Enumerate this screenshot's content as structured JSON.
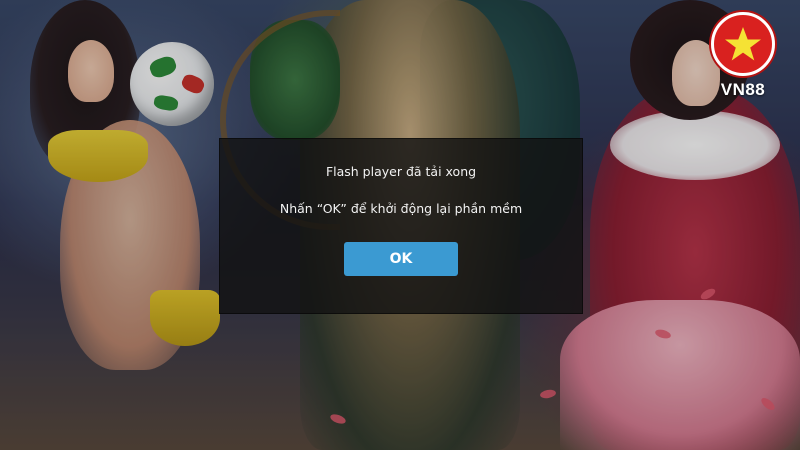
{
  "background": {
    "description_icon": "game-artwork-background"
  },
  "logo": {
    "text": "VN88",
    "icon": "star-icon",
    "circle_color": "#d9211f",
    "star_color": "#f5e234"
  },
  "dialog": {
    "title": "Flash player đã tải xong",
    "message": "Nhấn “OK” để khởi động lại phần mềm",
    "ok_label": "OK",
    "button_color": "#3b9ad2"
  }
}
